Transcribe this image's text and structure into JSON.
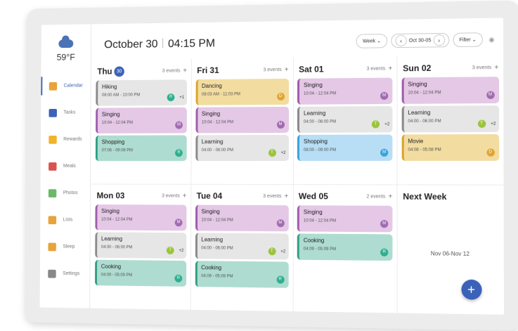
{
  "weather": {
    "temp": "59°F",
    "icon": "cloud-icon"
  },
  "nav": [
    {
      "label": "Calendar",
      "icon": "calendar-icon",
      "color": "#e8a33a",
      "active": true
    },
    {
      "label": "Tasks",
      "icon": "tasks-icon",
      "color": "#3b62b8",
      "active": false
    },
    {
      "label": "Rewards",
      "icon": "star-icon",
      "color": "#f0b429",
      "active": false
    },
    {
      "label": "Meals",
      "icon": "fork-knife-icon",
      "color": "#d9534f",
      "active": false
    },
    {
      "label": "Photos",
      "icon": "photo-icon",
      "color": "#6cb86a",
      "active": false
    },
    {
      "label": "Lists",
      "icon": "list-icon",
      "color": "#e8a33a",
      "active": false
    },
    {
      "label": "Sleep",
      "icon": "moon-icon",
      "color": "#e8a33a",
      "active": false
    },
    {
      "label": "Settings",
      "icon": "gear-icon",
      "color": "#888888",
      "active": false
    }
  ],
  "header": {
    "date": "October 30",
    "time": "04:15 PM",
    "view": "Week",
    "range": "Oct 30-05",
    "filter": "Filter",
    "view_chevron": "⌄",
    "prev_glyph": "‹",
    "next_glyph": "›",
    "wifi_glyph": "◉"
  },
  "days": [
    {
      "name": "Thu",
      "num": "30",
      "count": "3 events",
      "events": [
        {
          "title": "Hiking",
          "time": "08:00 AM - 10:00 PM",
          "style": "grey",
          "avatar": "R",
          "avatar_color": "#2fae8e",
          "more": "+1"
        },
        {
          "title": "Singing",
          "time": "10:04 - 12:04 PM",
          "style": "purple",
          "avatar": "M",
          "avatar_color": "#a06cb0",
          "more": ""
        },
        {
          "title": "Shopping",
          "time": "07:06 - 09:06 PM",
          "style": "teal",
          "avatar": "R",
          "avatar_color": "#2fae8e",
          "more": ""
        }
      ]
    },
    {
      "name": "Fri 31",
      "num": "",
      "count": "3 events",
      "events": [
        {
          "title": "Dancing",
          "time": "08:03 AM - 11:03 PM",
          "style": "yellow",
          "avatar": "D",
          "avatar_color": "#e0a530",
          "more": ""
        },
        {
          "title": "Singing",
          "time": "10:04 - 12:04 PM",
          "style": "purple",
          "avatar": "M",
          "avatar_color": "#a06cb0",
          "more": ""
        },
        {
          "title": "Learning",
          "time": "04:00 - 06:00 PM",
          "style": "grey",
          "avatar": "T",
          "avatar_color": "#9bc43d",
          "more": "+2"
        }
      ]
    },
    {
      "name": "Sat 01",
      "num": "",
      "count": "3 events",
      "events": [
        {
          "title": "Singing",
          "time": "10:04 - 12:04 PM",
          "style": "purple",
          "avatar": "M",
          "avatar_color": "#a06cb0",
          "more": ""
        },
        {
          "title": "Learning",
          "time": "04:00 - 06:00 PM",
          "style": "grey",
          "avatar": "T",
          "avatar_color": "#9bc43d",
          "more": "+2"
        },
        {
          "title": "Shopping",
          "time": "08:00 - 09:00 PM",
          "style": "blue",
          "avatar": "M",
          "avatar_color": "#3aa3d8",
          "more": ""
        }
      ]
    },
    {
      "name": "Sun 02",
      "num": "",
      "count": "3 events",
      "events": [
        {
          "title": "Singing",
          "time": "10:04 - 12:04 PM",
          "style": "purple",
          "avatar": "M",
          "avatar_color": "#a06cb0",
          "more": ""
        },
        {
          "title": "Learning",
          "time": "04:00 - 06:00 PM",
          "style": "grey",
          "avatar": "T",
          "avatar_color": "#9bc43d",
          "more": "+2"
        },
        {
          "title": "Movie",
          "time": "04:08 - 05:08 PM",
          "style": "yellow",
          "avatar": "D",
          "avatar_color": "#e0a530",
          "more": ""
        }
      ]
    },
    {
      "name": "Mon 03",
      "num": "",
      "count": "3 events",
      "events": [
        {
          "title": "Singing",
          "time": "10:04 - 12:04 PM",
          "style": "purple",
          "avatar": "M",
          "avatar_color": "#a06cb0",
          "more": ""
        },
        {
          "title": "Learning",
          "time": "04:00 - 06:00 PM",
          "style": "grey",
          "avatar": "T",
          "avatar_color": "#9bc43d",
          "more": "+2"
        },
        {
          "title": "Cooking",
          "time": "04:09 - 05:09 PM",
          "style": "teal",
          "avatar": "R",
          "avatar_color": "#2fae8e",
          "more": ""
        }
      ]
    },
    {
      "name": "Tue 04",
      "num": "",
      "count": "3 events",
      "events": [
        {
          "title": "Singing",
          "time": "10:04 - 12:04 PM",
          "style": "purple",
          "avatar": "M",
          "avatar_color": "#a06cb0",
          "more": ""
        },
        {
          "title": "Learning",
          "time": "04:00 - 06:00 PM",
          "style": "grey",
          "avatar": "T",
          "avatar_color": "#9bc43d",
          "more": "+2"
        },
        {
          "title": "Cooking",
          "time": "04:09 - 05:09 PM",
          "style": "teal",
          "avatar": "R",
          "avatar_color": "#2fae8e",
          "more": ""
        }
      ]
    },
    {
      "name": "Wed 05",
      "num": "",
      "count": "2 events",
      "events": [
        {
          "title": "Singing",
          "time": "10:04 - 12:04 PM",
          "style": "purple",
          "avatar": "M",
          "avatar_color": "#a06cb0",
          "more": ""
        },
        {
          "title": "Cooking",
          "time": "04:09 - 05:09 PM",
          "style": "teal",
          "avatar": "R",
          "avatar_color": "#2fae8e",
          "more": ""
        }
      ]
    }
  ],
  "next_week": {
    "title": "Next Week",
    "range": "Nov 06-Nov 12"
  },
  "fab": "+",
  "add_glyph": "+",
  "styles": {
    "grey": {
      "bg": "#e6e6e6",
      "bar": "#8a8a8a"
    },
    "purple": {
      "bg": "#e4c8e6",
      "bar": "#a05cad"
    },
    "teal": {
      "bg": "#aedcd0",
      "bar": "#2f9e84"
    },
    "yellow": {
      "bg": "#f2dca0",
      "bar": "#d9a52a"
    },
    "blue": {
      "bg": "#b7def5",
      "bar": "#3aa3d8"
    }
  }
}
